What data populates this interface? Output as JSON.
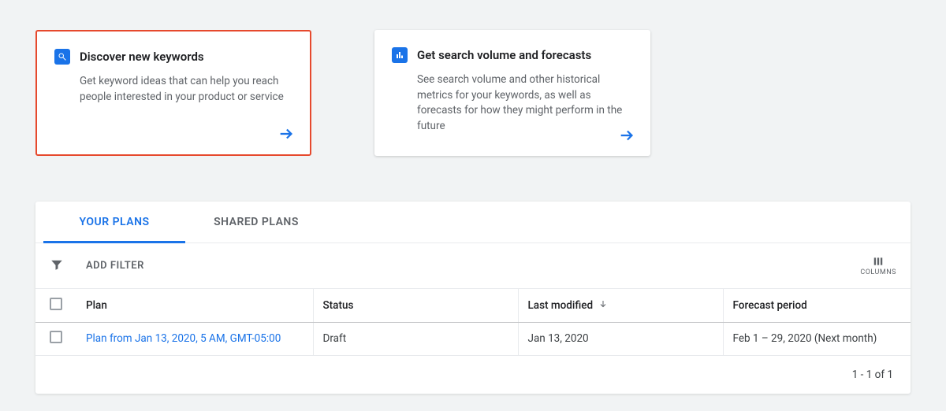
{
  "cards": {
    "discover": {
      "title": "Discover new keywords",
      "desc": "Get keyword ideas that can help you reach people interested in your product or service"
    },
    "forecast": {
      "title": "Get search volume and forecasts",
      "desc": "See search volume and other historical metrics for your keywords, as well as forecasts for how they might perform in the future"
    }
  },
  "tabs": {
    "your": "YOUR PLANS",
    "shared": "SHARED PLANS"
  },
  "filter": {
    "add": "ADD FILTER",
    "columns": "COLUMNS"
  },
  "table": {
    "headers": {
      "plan": "Plan",
      "status": "Status",
      "last_modified": "Last modified",
      "forecast_period": "Forecast period"
    },
    "rows": [
      {
        "plan": "Plan from Jan 13, 2020, 5 AM, GMT-05:00",
        "status": "Draft",
        "last_modified": "Jan 13, 2020",
        "forecast_period": "Feb 1 – 29, 2020 (Next month)"
      }
    ]
  },
  "pager": "1 - 1 of 1"
}
